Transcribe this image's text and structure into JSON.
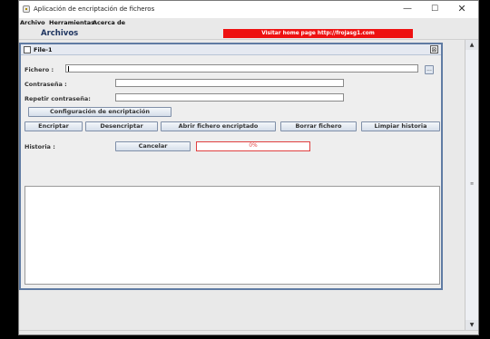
{
  "window": {
    "title": "Aplicación de encriptación de ficheros",
    "controls": {
      "minimize": "—",
      "maximize": "☐",
      "close": "✕"
    }
  },
  "menubar": {
    "items": [
      "Archivo",
      "Herramientas",
      "Acerca de"
    ]
  },
  "toolbar": {
    "title": "Archivos",
    "home_link": "Visitar home page http://frojasg1.com"
  },
  "internal_frame": {
    "title": "File-1",
    "close_glyph": "⊠"
  },
  "form": {
    "fichero_label": "Fichero :",
    "fichero_value": "",
    "browse_label": "...",
    "password_label": "Contraseña :",
    "password_value": "",
    "repeat_password_label": "Repetir contraseña:",
    "repeat_password_value": "",
    "config_button": "Configuración de encriptación",
    "actions": [
      "Encriptar",
      "Desencriptar",
      "Abrir fichero encriptado",
      "Borrar fichero",
      "Limpiar historia"
    ],
    "history_label": "Historia :",
    "cancel_button": "Cancelar",
    "progress_text": "0%",
    "progress_value": 0,
    "history_text": ""
  },
  "colors": {
    "home_link_bg": "#ee1111",
    "frame_border": "#5f7ba3",
    "progress_border": "#e04040"
  }
}
